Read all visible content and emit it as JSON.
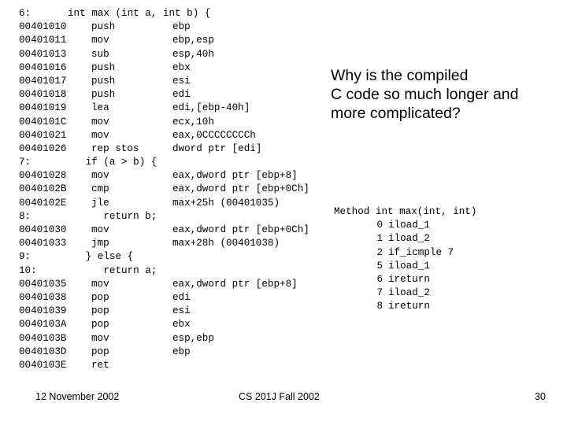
{
  "slide": {
    "page_number": "30",
    "background_color": "#ffffff",
    "text_color": "#000000"
  },
  "asm_listing": {
    "rows": [
      {
        "kind": "source",
        "num": "6:",
        "text": "int max (int a, int b) {"
      },
      {
        "kind": "code",
        "addr": "00401010",
        "mnem": "push",
        "oper": "ebp"
      },
      {
        "kind": "code",
        "addr": "00401011",
        "mnem": "mov",
        "oper": "ebp,esp"
      },
      {
        "kind": "code",
        "addr": "00401013",
        "mnem": "sub",
        "oper": "esp,40h"
      },
      {
        "kind": "code",
        "addr": "00401016",
        "mnem": "push",
        "oper": "ebx"
      },
      {
        "kind": "code",
        "addr": "00401017",
        "mnem": "push",
        "oper": "esi"
      },
      {
        "kind": "code",
        "addr": "00401018",
        "mnem": "push",
        "oper": "edi"
      },
      {
        "kind": "code",
        "addr": "00401019",
        "mnem": "lea",
        "oper": "edi,[ebp-40h]"
      },
      {
        "kind": "code",
        "addr": "0040101C",
        "mnem": "mov",
        "oper": "ecx,10h"
      },
      {
        "kind": "code",
        "addr": "00401021",
        "mnem": "mov",
        "oper": "eax,0CCCCCCCCh"
      },
      {
        "kind": "code",
        "addr": "00401026",
        "mnem": "rep stos",
        "oper": "dword ptr [edi]"
      },
      {
        "kind": "source",
        "num": "7:",
        "text": "   if (a > b) {"
      },
      {
        "kind": "code",
        "addr": "00401028",
        "mnem": "mov",
        "oper": "eax,dword ptr [ebp+8]"
      },
      {
        "kind": "code",
        "addr": "0040102B",
        "mnem": "cmp",
        "oper": "eax,dword ptr [ebp+0Ch]"
      },
      {
        "kind": "code",
        "addr": "0040102E",
        "mnem": "jle",
        "oper": "max+25h (00401035)"
      },
      {
        "kind": "source",
        "num": "8:",
        "text": "      return b;"
      },
      {
        "kind": "code",
        "addr": "00401030",
        "mnem": "mov",
        "oper": "eax,dword ptr [ebp+0Ch]"
      },
      {
        "kind": "code",
        "addr": "00401033",
        "mnem": "jmp",
        "oper": "max+28h (00401038)"
      },
      {
        "kind": "source",
        "num": "9:",
        "text": "   } else {"
      },
      {
        "kind": "source",
        "num": "10:",
        "text": "      return a;"
      },
      {
        "kind": "code",
        "addr": "00401035",
        "mnem": "mov",
        "oper": "eax,dword ptr [ebp+8]"
      },
      {
        "kind": "code",
        "addr": "00401038",
        "mnem": "pop",
        "oper": "edi"
      },
      {
        "kind": "code",
        "addr": "00401039",
        "mnem": "pop",
        "oper": "esi"
      },
      {
        "kind": "code",
        "addr": "0040103A",
        "mnem": "pop",
        "oper": "ebx"
      },
      {
        "kind": "code",
        "addr": "0040103B",
        "mnem": "mov",
        "oper": "esp,ebp"
      },
      {
        "kind": "code",
        "addr": "0040103D",
        "mnem": "pop",
        "oper": "ebp"
      },
      {
        "kind": "code",
        "addr": "0040103E",
        "mnem": "ret",
        "oper": ""
      }
    ]
  },
  "question": {
    "lines": [
      "Why is the compiled",
      "C code so much longer and",
      "more complicated?"
    ]
  },
  "bytecode": {
    "header": "Method int max(int, int)",
    "instructions": [
      {
        "index": "0",
        "op": "iload_1"
      },
      {
        "index": "1",
        "op": "iload_2"
      },
      {
        "index": "2",
        "op": "if_icmple 7"
      },
      {
        "index": "5",
        "op": "iload_1"
      },
      {
        "index": "6",
        "op": "ireturn"
      },
      {
        "index": "7",
        "op": "iload_2"
      },
      {
        "index": "8",
        "op": "ireturn"
      }
    ]
  },
  "footer": {
    "date": "12 November 2002",
    "course": "CS 201J Fall 2002",
    "page": "30"
  }
}
